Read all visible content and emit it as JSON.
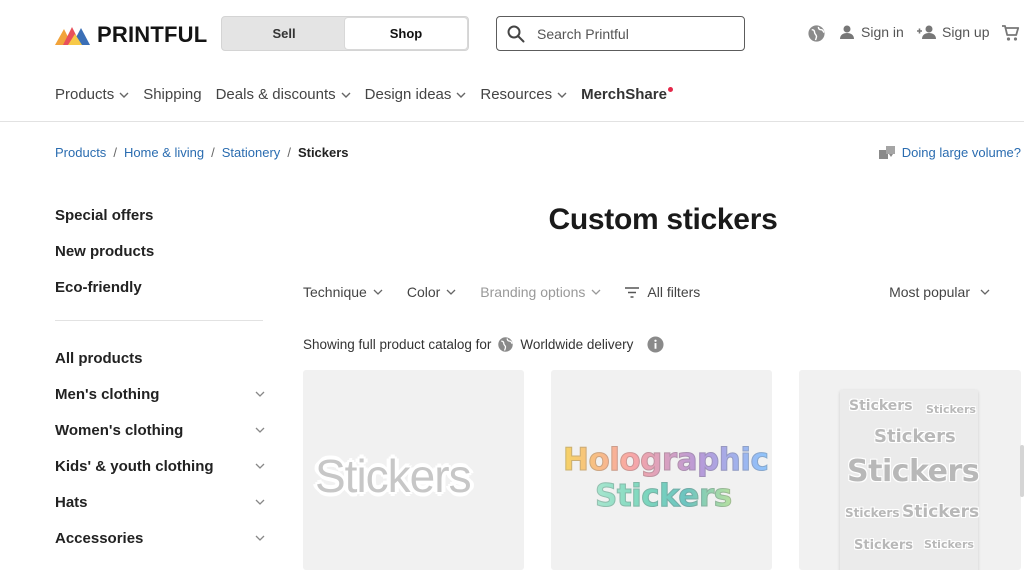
{
  "header": {
    "brand": "PRINTFUL",
    "toggle": {
      "sell": "Sell",
      "shop": "Shop"
    },
    "search": {
      "placeholder": "Search Printful"
    },
    "sign_in": "Sign in",
    "sign_up": "Sign up"
  },
  "nav": {
    "items": [
      "Products",
      "Shipping",
      "Deals & discounts",
      "Design ideas",
      "Resources"
    ],
    "merchshare": "MerchShare"
  },
  "breadcrumb": {
    "items": [
      "Products",
      "Home & living",
      "Stationery"
    ],
    "current": "Stickers"
  },
  "volume_link": "Doing large volume?",
  "sidebar": {
    "top": [
      "Special offers",
      "New products",
      "Eco-friendly"
    ],
    "categories": [
      "All products",
      "Men's clothing",
      "Women's clothing",
      "Kids' & youth clothing",
      "Hats",
      "Accessories"
    ]
  },
  "page": {
    "title": "Custom stickers",
    "filters": {
      "technique": "Technique",
      "color": "Color",
      "branding": "Branding options",
      "all": "All filters"
    },
    "sort": "Most popular",
    "catalog_text": "Showing full product catalog for",
    "delivery": "Worldwide delivery"
  },
  "cards": {
    "card1": "Stickers",
    "card2": [
      "Holographic",
      "Stickers"
    ],
    "card3": [
      "Stickers",
      "Stickers",
      "Stickers",
      "Stickers",
      "Stickers",
      "Stickers",
      "Stickers",
      "Stickers"
    ]
  },
  "colors": {
    "link": "#2a6cb0",
    "accent_dot": "#e4284a"
  }
}
